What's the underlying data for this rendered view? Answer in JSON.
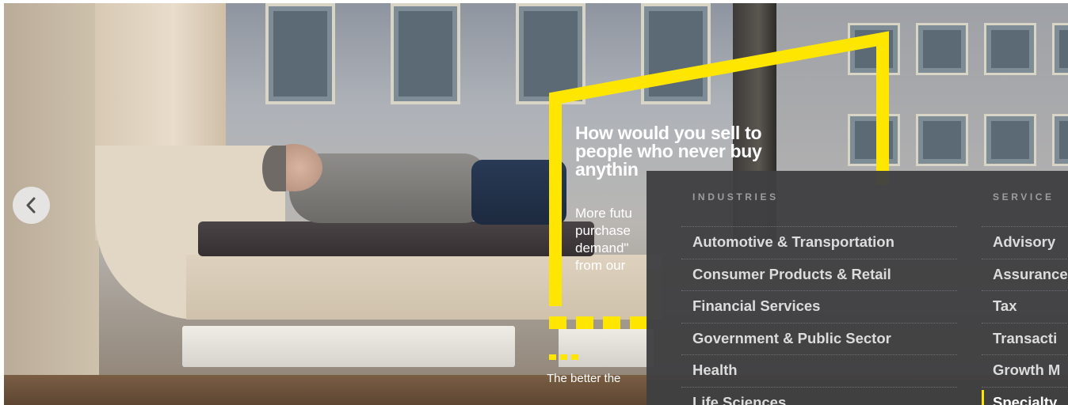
{
  "hero": {
    "headline_lines": [
      "How would you sell to",
      "people who never buy",
      "anythin"
    ],
    "subtext_lines": [
      "More futu",
      "purchase",
      "demand\"",
      "from our"
    ],
    "caption": "The better the",
    "accent_color": "#ffe600"
  },
  "carousel": {
    "prev_icon": "chevron-left-icon"
  },
  "menu": {
    "industries": {
      "heading": "INDUSTRIES",
      "items": [
        "Automotive & Transportation",
        "Consumer Products & Retail",
        "Financial Services",
        "Government & Public Sector",
        "Health",
        "Life Sciences"
      ]
    },
    "services": {
      "heading": "SERVICE",
      "items": [
        "Advisory",
        "Assurance",
        "Tax",
        "Transacti",
        "Growth M",
        "Specialty"
      ],
      "active_index": 5
    }
  }
}
